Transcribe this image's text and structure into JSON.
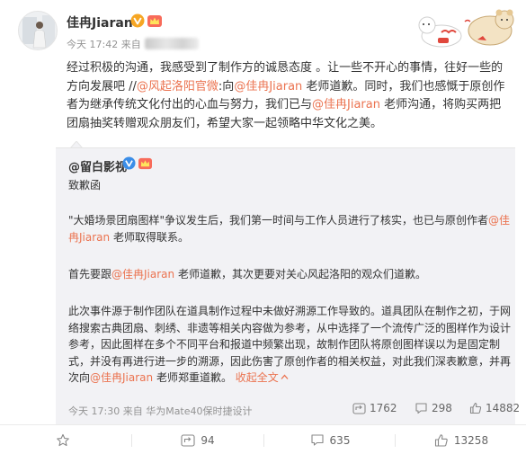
{
  "post": {
    "author": "佳冉Jiaran",
    "time": "今天 17:42",
    "source_prefix": "来自",
    "text": {
      "part1": "经过积极的沟通，我感受到了制作方的诚恳态度 。让一些不开心的事情，往好一些的方向发展吧 //",
      "mention1": "@风起洛阳官微",
      "part2": ":向",
      "mention2": "@佳冉Jiaran",
      "part3": " 老师道歉。同时，我们也感慨于原创作者为继承传统文化付出的心血与努力，我们已与",
      "mention3": "@佳冉Jiaran",
      "part4": " 老师沟通，将购买两把团扇抽奖转赠观众朋友们，希望大家一起领略中华文化之美。"
    }
  },
  "quote": {
    "author": "@留白影视",
    "subtitle": "致歉函",
    "p1": {
      "a": "\"大婚场景团扇图样\"争议发生后，我们第一时间与工作人员进行了核实，也已与原创作者",
      "mention": "@佳冉Jiaran",
      "b": " 老师取得联系。"
    },
    "p2": {
      "a": "首先要跟",
      "mention": "@佳冉Jiaran",
      "b": " 老师道歉，其次更要对关心风起洛阳的观众们道歉。"
    },
    "p3": {
      "a": "此次事件源于制作团队在道具制作过程中未做好溯源工作导致的。道具团队在制作之初，于网络搜索古典团扇、刺绣、非遗等相关内容做为参考，从中选择了一个流传广泛的图样作为设计参考，因此图样在多个不同平台和报道中频繁出现，故制作团队将原创图样误以为是固定制式，并没有再进行进一步的溯源，因此伤害了原创作者的相关权益，对此我们深表歉意，并再次向",
      "mention": "@佳冉Jiaran",
      "b": " 老师郑重道歉。",
      "collapse": "收起全文",
      "collapse_icon": "up-arrow-icon"
    },
    "time": "今天 17:30",
    "source": "来自 华为Mate40保时捷设计",
    "stats": {
      "reposts": "1762",
      "comments": "298",
      "likes": "14882"
    }
  },
  "actions": {
    "favorite": "",
    "repost": "94",
    "comment": "635",
    "like": "13258"
  },
  "colors": {
    "link": "#eb7350",
    "badge_v": "#f6a623",
    "muted": "#939393"
  }
}
